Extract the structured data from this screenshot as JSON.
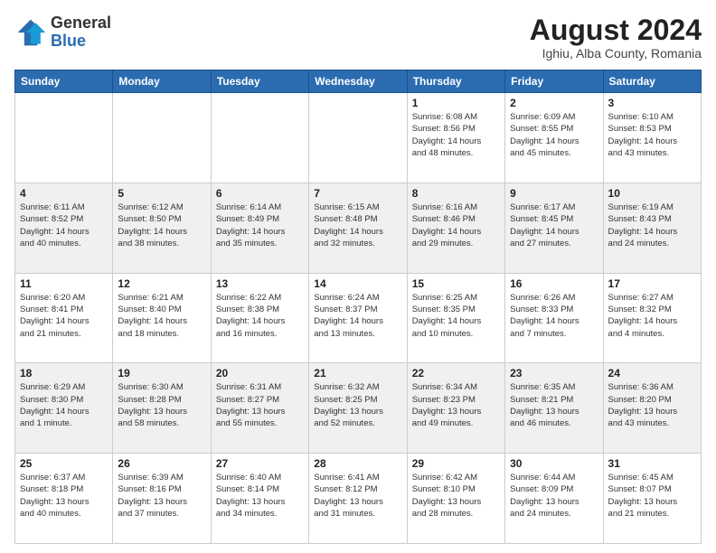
{
  "header": {
    "logo_general": "General",
    "logo_blue": "Blue",
    "month_year": "August 2024",
    "location": "Ighiu, Alba County, Romania"
  },
  "days_of_week": [
    "Sunday",
    "Monday",
    "Tuesday",
    "Wednesday",
    "Thursday",
    "Friday",
    "Saturday"
  ],
  "weeks": [
    [
      {
        "num": "",
        "info": ""
      },
      {
        "num": "",
        "info": ""
      },
      {
        "num": "",
        "info": ""
      },
      {
        "num": "",
        "info": ""
      },
      {
        "num": "1",
        "info": "Sunrise: 6:08 AM\nSunset: 8:56 PM\nDaylight: 14 hours\nand 48 minutes."
      },
      {
        "num": "2",
        "info": "Sunrise: 6:09 AM\nSunset: 8:55 PM\nDaylight: 14 hours\nand 45 minutes."
      },
      {
        "num": "3",
        "info": "Sunrise: 6:10 AM\nSunset: 8:53 PM\nDaylight: 14 hours\nand 43 minutes."
      }
    ],
    [
      {
        "num": "4",
        "info": "Sunrise: 6:11 AM\nSunset: 8:52 PM\nDaylight: 14 hours\nand 40 minutes."
      },
      {
        "num": "5",
        "info": "Sunrise: 6:12 AM\nSunset: 8:50 PM\nDaylight: 14 hours\nand 38 minutes."
      },
      {
        "num": "6",
        "info": "Sunrise: 6:14 AM\nSunset: 8:49 PM\nDaylight: 14 hours\nand 35 minutes."
      },
      {
        "num": "7",
        "info": "Sunrise: 6:15 AM\nSunset: 8:48 PM\nDaylight: 14 hours\nand 32 minutes."
      },
      {
        "num": "8",
        "info": "Sunrise: 6:16 AM\nSunset: 8:46 PM\nDaylight: 14 hours\nand 29 minutes."
      },
      {
        "num": "9",
        "info": "Sunrise: 6:17 AM\nSunset: 8:45 PM\nDaylight: 14 hours\nand 27 minutes."
      },
      {
        "num": "10",
        "info": "Sunrise: 6:19 AM\nSunset: 8:43 PM\nDaylight: 14 hours\nand 24 minutes."
      }
    ],
    [
      {
        "num": "11",
        "info": "Sunrise: 6:20 AM\nSunset: 8:41 PM\nDaylight: 14 hours\nand 21 minutes."
      },
      {
        "num": "12",
        "info": "Sunrise: 6:21 AM\nSunset: 8:40 PM\nDaylight: 14 hours\nand 18 minutes."
      },
      {
        "num": "13",
        "info": "Sunrise: 6:22 AM\nSunset: 8:38 PM\nDaylight: 14 hours\nand 16 minutes."
      },
      {
        "num": "14",
        "info": "Sunrise: 6:24 AM\nSunset: 8:37 PM\nDaylight: 14 hours\nand 13 minutes."
      },
      {
        "num": "15",
        "info": "Sunrise: 6:25 AM\nSunset: 8:35 PM\nDaylight: 14 hours\nand 10 minutes."
      },
      {
        "num": "16",
        "info": "Sunrise: 6:26 AM\nSunset: 8:33 PM\nDaylight: 14 hours\nand 7 minutes."
      },
      {
        "num": "17",
        "info": "Sunrise: 6:27 AM\nSunset: 8:32 PM\nDaylight: 14 hours\nand 4 minutes."
      }
    ],
    [
      {
        "num": "18",
        "info": "Sunrise: 6:29 AM\nSunset: 8:30 PM\nDaylight: 14 hours\nand 1 minute."
      },
      {
        "num": "19",
        "info": "Sunrise: 6:30 AM\nSunset: 8:28 PM\nDaylight: 13 hours\nand 58 minutes."
      },
      {
        "num": "20",
        "info": "Sunrise: 6:31 AM\nSunset: 8:27 PM\nDaylight: 13 hours\nand 55 minutes."
      },
      {
        "num": "21",
        "info": "Sunrise: 6:32 AM\nSunset: 8:25 PM\nDaylight: 13 hours\nand 52 minutes."
      },
      {
        "num": "22",
        "info": "Sunrise: 6:34 AM\nSunset: 8:23 PM\nDaylight: 13 hours\nand 49 minutes."
      },
      {
        "num": "23",
        "info": "Sunrise: 6:35 AM\nSunset: 8:21 PM\nDaylight: 13 hours\nand 46 minutes."
      },
      {
        "num": "24",
        "info": "Sunrise: 6:36 AM\nSunset: 8:20 PM\nDaylight: 13 hours\nand 43 minutes."
      }
    ],
    [
      {
        "num": "25",
        "info": "Sunrise: 6:37 AM\nSunset: 8:18 PM\nDaylight: 13 hours\nand 40 minutes."
      },
      {
        "num": "26",
        "info": "Sunrise: 6:39 AM\nSunset: 8:16 PM\nDaylight: 13 hours\nand 37 minutes."
      },
      {
        "num": "27",
        "info": "Sunrise: 6:40 AM\nSunset: 8:14 PM\nDaylight: 13 hours\nand 34 minutes."
      },
      {
        "num": "28",
        "info": "Sunrise: 6:41 AM\nSunset: 8:12 PM\nDaylight: 13 hours\nand 31 minutes."
      },
      {
        "num": "29",
        "info": "Sunrise: 6:42 AM\nSunset: 8:10 PM\nDaylight: 13 hours\nand 28 minutes."
      },
      {
        "num": "30",
        "info": "Sunrise: 6:44 AM\nSunset: 8:09 PM\nDaylight: 13 hours\nand 24 minutes."
      },
      {
        "num": "31",
        "info": "Sunrise: 6:45 AM\nSunset: 8:07 PM\nDaylight: 13 hours\nand 21 minutes."
      }
    ]
  ]
}
